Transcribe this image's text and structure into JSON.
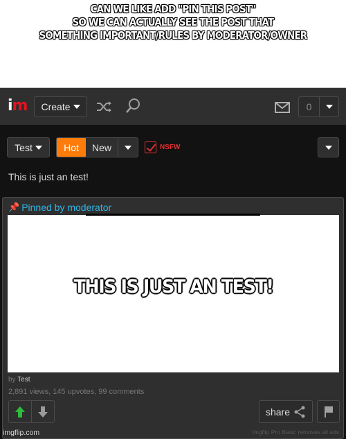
{
  "caption": {
    "lines": [
      "CAN WE LIKE ADD \"PIN THIS POST\"",
      "SO WE CAN ACTUALLY SEE THE POST THAT",
      "SOMETHING IMPORTANT/RULES BY MODERATOR/OWNER"
    ]
  },
  "topbar": {
    "logo_i": "i",
    "logo_m": "m",
    "create_label": "Create",
    "notification_count": "0",
    "icons": [
      "shuffle-icon",
      "search-icon",
      "mail-icon",
      "chevron-down-icon"
    ]
  },
  "filters": {
    "stream_label": "Test",
    "sort_hot": "Hot",
    "sort_new": "New",
    "nsfw_label": "NSFW",
    "nsfw_checked": true
  },
  "stream_description": "This is just an test!",
  "post": {
    "pinned_label": "Pinned by moderator",
    "meme_text": "THIS IS JUST AN TEST!",
    "by_prefix": "by",
    "author": "Test",
    "stats": "2,891 views, 145 upvotes, 99 comments",
    "share_label": "share",
    "pro_notice": "Imgflip Pro Basic removes all ads"
  },
  "watermark": "imgflip.com",
  "colors": {
    "accent_orange": "#ff7c0a",
    "logo_red": "#e0131e",
    "pinned_blue": "#2fb6e6",
    "upvote_green": "#2ebd3a",
    "nsfw_red": "#e03030"
  }
}
